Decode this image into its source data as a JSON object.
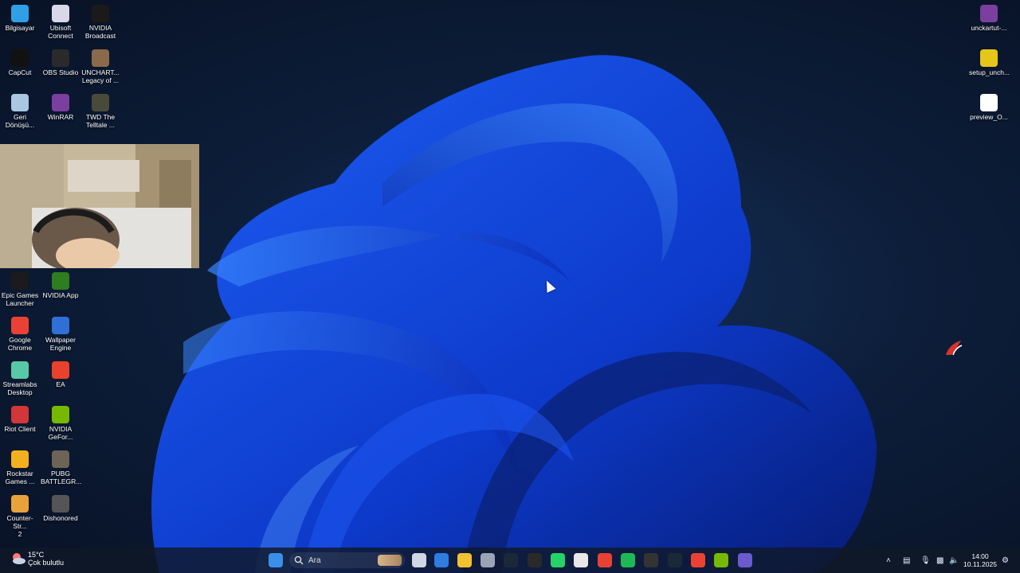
{
  "desktop_icons_left": [
    {
      "label": "Bilgisayar",
      "icon": "computer-icon",
      "color": "#2fa0e6"
    },
    {
      "label": "Ubisoft\nConnect",
      "icon": "ubisoft-icon",
      "color": "#d8d8e8"
    },
    {
      "label": "NVIDIA\nBroadcast",
      "icon": "nvidia-broadcast-icon",
      "color": "#1a1a1a"
    },
    {
      "label": "CapCut",
      "icon": "capcut-icon",
      "color": "#111111"
    },
    {
      "label": "OBS Studio",
      "icon": "obs-icon",
      "color": "#2a2a2a"
    },
    {
      "label": "UNCHART...\nLegacy of ...",
      "icon": "uncharted-icon",
      "color": "#8a6a4a"
    },
    {
      "label": "Geri\nDönüşü...",
      "icon": "recycle-bin-icon",
      "color": "#a9c7e0"
    },
    {
      "label": "WinRAR",
      "icon": "winrar-icon",
      "color": "#7b3fa0"
    },
    {
      "label": "TWD The\nTelltale ...",
      "icon": "twd-icon",
      "color": "#4a4a3a"
    },
    {
      "label": "Epic Games\nLauncher",
      "icon": "epic-games-icon",
      "color": "#1b1b1b"
    },
    {
      "label": "NVIDIA App",
      "icon": "nvidia-app-icon",
      "color": "#2e7d1f"
    },
    {
      "label": "Google\nChrome",
      "icon": "chrome-icon",
      "color": "#e94235"
    },
    {
      "label": "Wallpaper\nEngine",
      "icon": "wallpaper-engine-icon",
      "color": "#2f6fd6"
    },
    {
      "label": "Streamlabs\nDesktop",
      "icon": "streamlabs-icon",
      "color": "#58c9a6"
    },
    {
      "label": "EA",
      "icon": "ea-icon",
      "color": "#e8412c"
    },
    {
      "label": "Riot Client",
      "icon": "riot-client-icon",
      "color": "#d13639"
    },
    {
      "label": "NVIDIA\nGeFor...",
      "icon": "geforce-icon",
      "color": "#76b900"
    },
    {
      "label": "Rockstar\nGames ...",
      "icon": "rockstar-icon",
      "color": "#f2b01e"
    },
    {
      "label": "PUBG\nBATTLEGR...",
      "icon": "pubg-icon",
      "color": "#6d6455"
    },
    {
      "label": "Counter-Str...\n2",
      "icon": "cs2-icon",
      "color": "#e8a23a"
    },
    {
      "label": "Dishonored",
      "icon": "dishonored-icon",
      "color": "#555555"
    }
  ],
  "desktop_icons_right": [
    {
      "label": "unckartut-...",
      "icon": "winrar-archive-icon",
      "color": "#7b3fa0"
    },
    {
      "label": "setup_unch...",
      "icon": "setup-icon",
      "color": "#e6c619"
    },
    {
      "label": "preview_O...",
      "icon": "file-icon",
      "color": "#ffffff"
    }
  ],
  "taskbar": {
    "weather": {
      "temp": "15°C",
      "desc": "Çok bulutlu"
    },
    "search_placeholder": "Ara",
    "apps": [
      {
        "icon": "start-icon",
        "color": "#3a8fe8"
      },
      {
        "icon": "task-view-icon",
        "color": "#cfd6e4"
      },
      {
        "icon": "store-icon",
        "color": "#2f7de0"
      },
      {
        "icon": "file-explorer-icon",
        "color": "#f2c230"
      },
      {
        "icon": "settings-icon",
        "color": "#9aa4b6"
      },
      {
        "icon": "steam-icon",
        "color": "#1b2838"
      },
      {
        "icon": "epic-games-icon",
        "color": "#2a2a2a"
      },
      {
        "icon": "whatsapp-icon",
        "color": "#25d366"
      },
      {
        "icon": "chatgpt-icon",
        "color": "#e8e8e8"
      },
      {
        "icon": "chrome-icon",
        "color": "#e94235"
      },
      {
        "icon": "spotify-icon",
        "color": "#1db954"
      },
      {
        "icon": "obs-icon",
        "color": "#333333"
      },
      {
        "icon": "steam-icon-2",
        "color": "#1b2838"
      },
      {
        "icon": "chrome-icon-2",
        "color": "#e94235"
      },
      {
        "icon": "nvidia-icon",
        "color": "#76b900"
      },
      {
        "icon": "cortana-icon",
        "color": "#6a5acd"
      }
    ],
    "clock": {
      "time": "14:00",
      "date": "10.11.2025"
    }
  },
  "accent": "#1f5bff"
}
